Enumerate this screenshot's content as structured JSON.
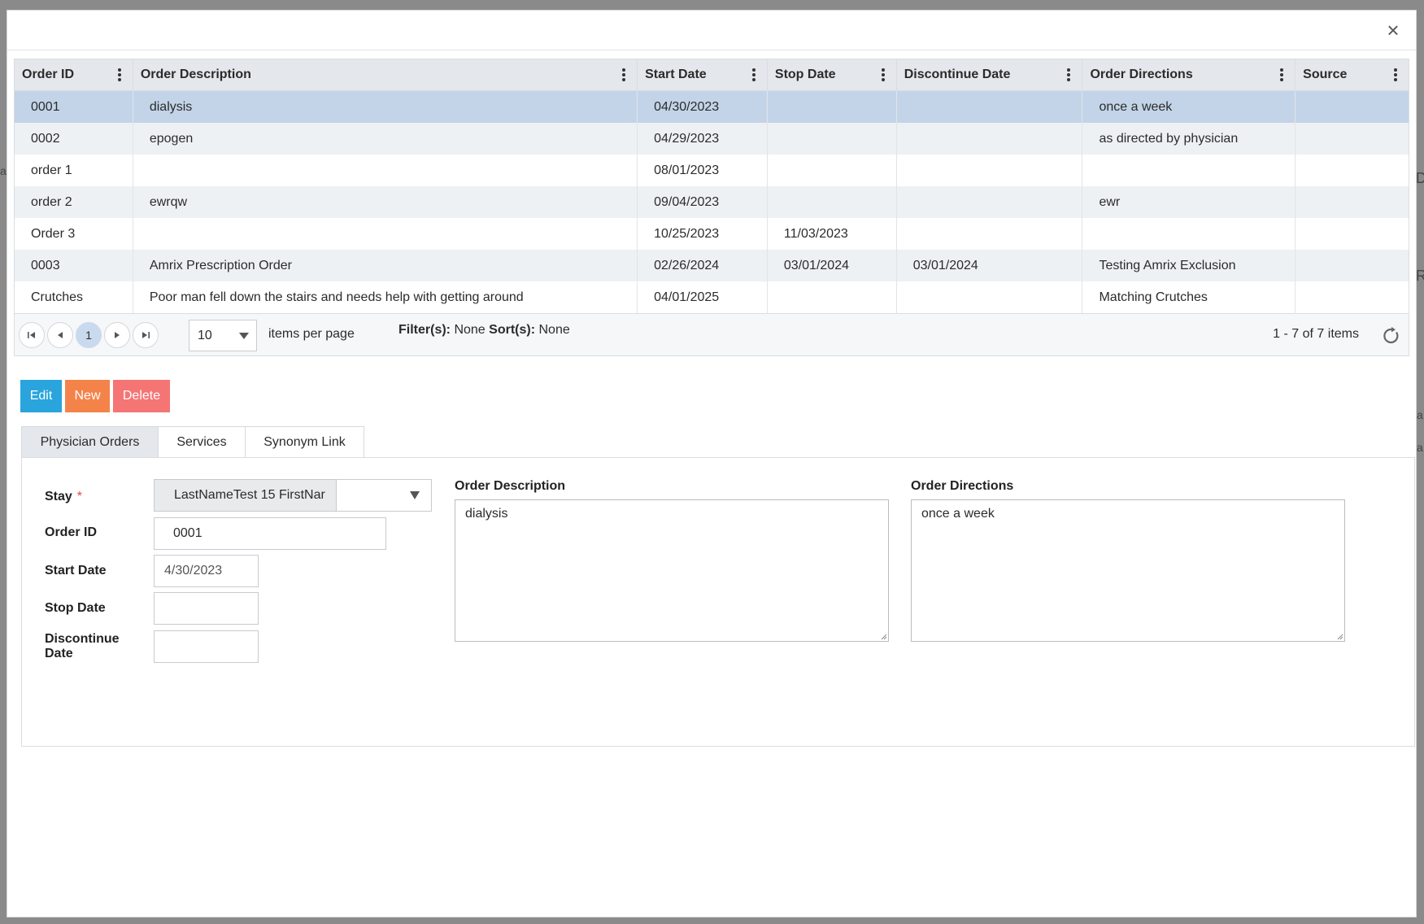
{
  "backdrop": {
    "glyphs": [
      "a",
      "D",
      "R",
      "a",
      "a"
    ]
  },
  "modal": {
    "close_label": "×"
  },
  "grid": {
    "columns": [
      "Order ID",
      "Order Description",
      "Start Date",
      "Stop Date",
      "Discontinue Date",
      "Order Directions",
      "Source"
    ],
    "rows": [
      {
        "order_id": "0001",
        "description": "dialysis",
        "start": "04/30/2023",
        "stop": "",
        "discontinue": "",
        "directions": "once a week",
        "source": ""
      },
      {
        "order_id": "0002",
        "description": "epogen",
        "start": "04/29/2023",
        "stop": "",
        "discontinue": "",
        "directions": "as directed by physician",
        "source": ""
      },
      {
        "order_id": "order 1",
        "description": "",
        "start": "08/01/2023",
        "stop": "",
        "discontinue": "",
        "directions": "",
        "source": ""
      },
      {
        "order_id": "order 2",
        "description": "ewrqw",
        "start": "09/04/2023",
        "stop": "",
        "discontinue": "",
        "directions": "ewr",
        "source": ""
      },
      {
        "order_id": "Order 3",
        "description": "",
        "start": "10/25/2023",
        "stop": "11/03/2023",
        "discontinue": "",
        "directions": "",
        "source": ""
      },
      {
        "order_id": "0003",
        "description": "Amrix Prescription Order",
        "start": "02/26/2024",
        "stop": "03/01/2024",
        "discontinue": "03/01/2024",
        "directions": "Testing Amrix Exclusion",
        "source": ""
      },
      {
        "order_id": "Crutches",
        "description": "Poor man fell down the stairs and needs help with getting around",
        "start": "04/01/2025",
        "stop": "",
        "discontinue": "",
        "directions": "Matching Crutches",
        "source": ""
      }
    ],
    "selected_row": 0
  },
  "pager": {
    "current_page": "1",
    "page_size": "10",
    "items_per_page_label": "items per page",
    "filter_label": "Filter(s):",
    "filter_value": "None",
    "sort_label": "Sort(s):",
    "sort_value": "None",
    "summary": "1 - 7 of 7 items"
  },
  "actions": {
    "edit": "Edit",
    "new": "New",
    "delete": "Delete"
  },
  "tabs": [
    {
      "label": "Physician Orders",
      "active": true
    },
    {
      "label": "Services",
      "active": false
    },
    {
      "label": "Synonym Link",
      "active": false
    }
  ],
  "form": {
    "stay_label": "Stay",
    "stay_required": "*",
    "stay_value": "LastNameTest 15 FirstNar",
    "order_id_label": "Order ID",
    "order_id_value": "0001",
    "start_date_label": "Start Date",
    "start_date_value": "4/30/2023",
    "stop_date_label": "Stop Date",
    "stop_date_value": "",
    "discontinue_label_line1": "Discontinue",
    "discontinue_label_line2": "Date",
    "discontinue_value": "",
    "order_description_label": "Order Description",
    "order_description_value": "dialysis",
    "order_directions_label": "Order Directions",
    "order_directions_value": "once a week"
  },
  "colors": {
    "selected_row": "#c3d4e8",
    "alt_row": "#eef1f4",
    "header_bg": "#e4e7eb",
    "edit_button": "#2aa4dc",
    "new_button": "#f4834a",
    "delete_button": "#f57575",
    "required_star": "#e64545"
  }
}
